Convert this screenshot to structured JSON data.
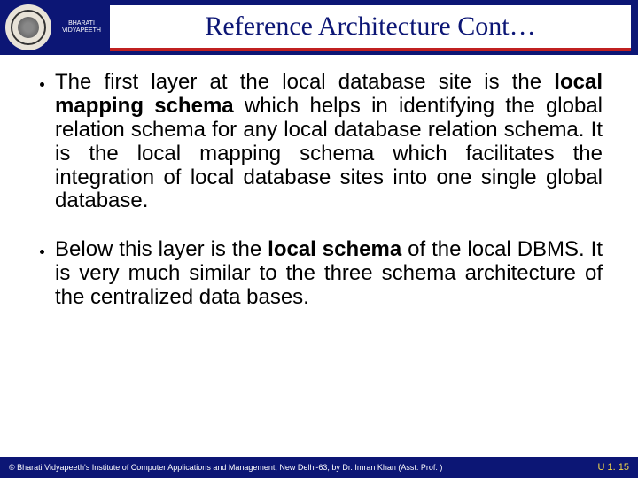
{
  "header": {
    "logo_top": "BHARATI",
    "logo_bottom": "VIDYAPEETH",
    "title": "Reference Architecture Cont…"
  },
  "bullets": [
    {
      "pre": "The first layer at the local database site is the ",
      "bold1": "local mapping schema",
      "post": " which helps in identifying the global relation schema for any local database relation schema. It is the local mapping schema which facilitates the integration of local database sites into one single global database."
    },
    {
      "pre": "Below this layer is the ",
      "bold1": "local schema",
      "post": " of the local DBMS. It is very much similar to the three schema architecture of the centralized data bases."
    }
  ],
  "footer": {
    "left": "© Bharati Vidyapeeth's Institute of Computer Applications and Management, New Delhi-63,  by  Dr. Imran Khan (Asst. Prof. )",
    "right": "U 1. 15"
  }
}
